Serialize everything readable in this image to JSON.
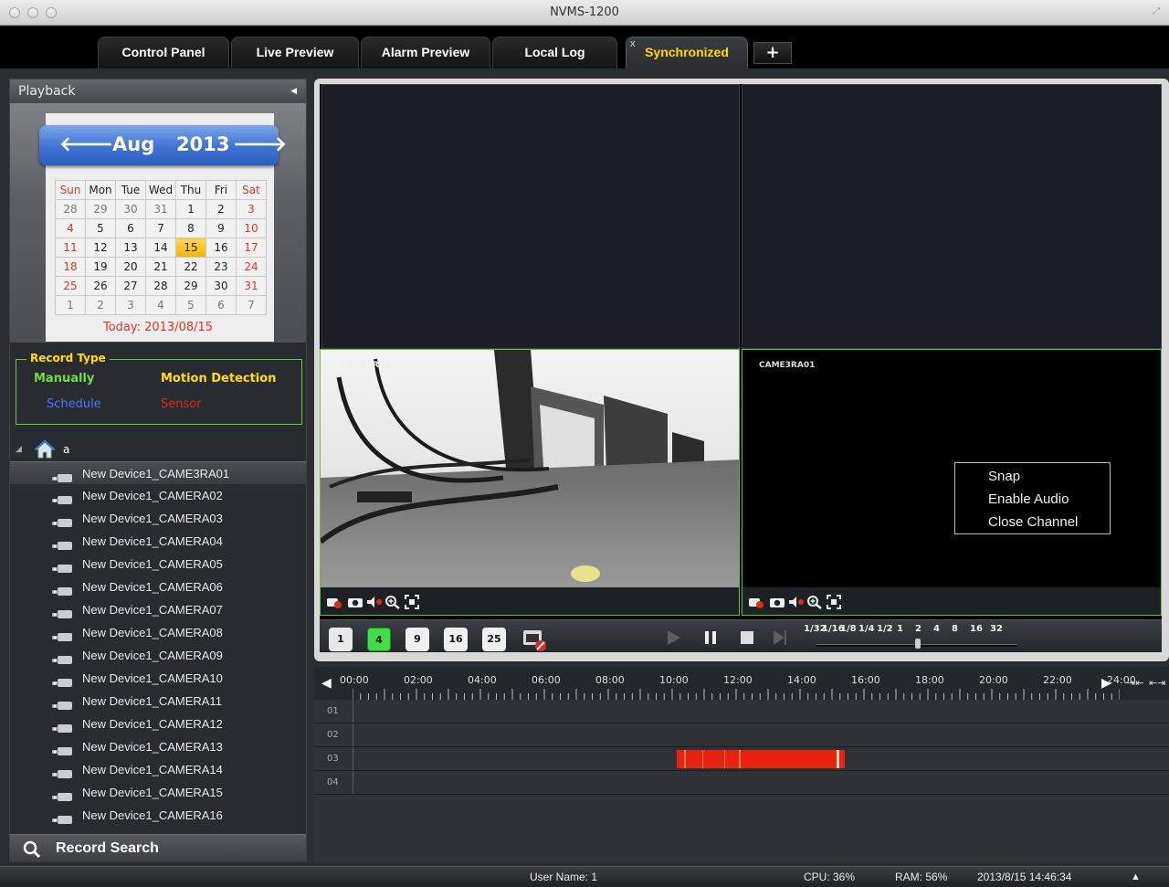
{
  "window": {
    "title": "NVMS-1200"
  },
  "tabs": [
    {
      "label": "Control Panel"
    },
    {
      "label": "Live Preview"
    },
    {
      "label": "Alarm Preview"
    },
    {
      "label": "Local Log"
    },
    {
      "label": "Synchronized",
      "active": true,
      "close": "x"
    }
  ],
  "add_tab_label": "+",
  "sidebar": {
    "header": "Playback",
    "calendar": {
      "month": "Aug",
      "year": "2013",
      "weekdays": [
        "Sun",
        "Mon",
        "Tue",
        "Wed",
        "Thu",
        "Fri",
        "Sat"
      ],
      "weeks": [
        [
          "28",
          "29",
          "30",
          "31",
          "1",
          "2",
          "3"
        ],
        [
          "4",
          "5",
          "6",
          "7",
          "8",
          "9",
          "10"
        ],
        [
          "11",
          "12",
          "13",
          "14",
          "15",
          "16",
          "17"
        ],
        [
          "18",
          "19",
          "20",
          "21",
          "22",
          "23",
          "24"
        ],
        [
          "25",
          "26",
          "27",
          "28",
          "29",
          "30",
          "31"
        ],
        [
          "1",
          "2",
          "3",
          "4",
          "5",
          "6",
          "7"
        ]
      ],
      "selected_day": "15",
      "today_text": "Today: 2013/08/15"
    },
    "record_type": {
      "title": "Record Type",
      "manually": "Manually",
      "motion": "Motion Detection",
      "schedule": "Schedule",
      "sensor": "Sensor",
      "colors": {
        "manually": "#6fe03a",
        "motion": "#ffe000",
        "schedule": "#4a78ff",
        "sensor": "#e02a1a"
      }
    },
    "tree_root": "a",
    "devices": [
      "New Device1_CAME3RA01",
      "New Device1_CAMERA02",
      "New Device1_CAMERA03",
      "New Device1_CAMERA04",
      "New Device1_CAMERA05",
      "New Device1_CAMERA06",
      "New Device1_CAMERA07",
      "New Device1_CAMERA08",
      "New Device1_CAMERA09",
      "New Device1_CAMERA10",
      "New Device1_CAMERA11",
      "New Device1_CAMERA12",
      "New Device1_CAMERA13",
      "New Device1_CAMERA14",
      "New Device1_CAMERA15",
      "New Device1_CAMERA16"
    ],
    "record_search": "Record Search"
  },
  "video": {
    "channel_overlay": "CAME3RA01",
    "context_menu": [
      "Snap",
      "Enable Audio",
      "Close Channel"
    ]
  },
  "layout_buttons": [
    "1",
    "4",
    "9",
    "16",
    "25"
  ],
  "speeds": [
    "1/32",
    "1/16",
    "1/8",
    "1/4",
    "1/2",
    "1",
    "2",
    "4",
    "8",
    "16",
    "32"
  ],
  "timeline": {
    "hours": [
      "00:00",
      "02:00",
      "04:00",
      "06:00",
      "08:00",
      "10:00",
      "12:00",
      "14:00",
      "16:00",
      "18:00",
      "20:00",
      "22:00",
      "24:00"
    ],
    "rows": [
      "01",
      "02",
      "03",
      "04"
    ],
    "record_color": "#e8220c"
  },
  "status": {
    "user": "User Name: 1",
    "cpu": "CPU: 36%",
    "ram": "RAM: 56%",
    "datetime": "2013/8/15 14:46:34"
  }
}
